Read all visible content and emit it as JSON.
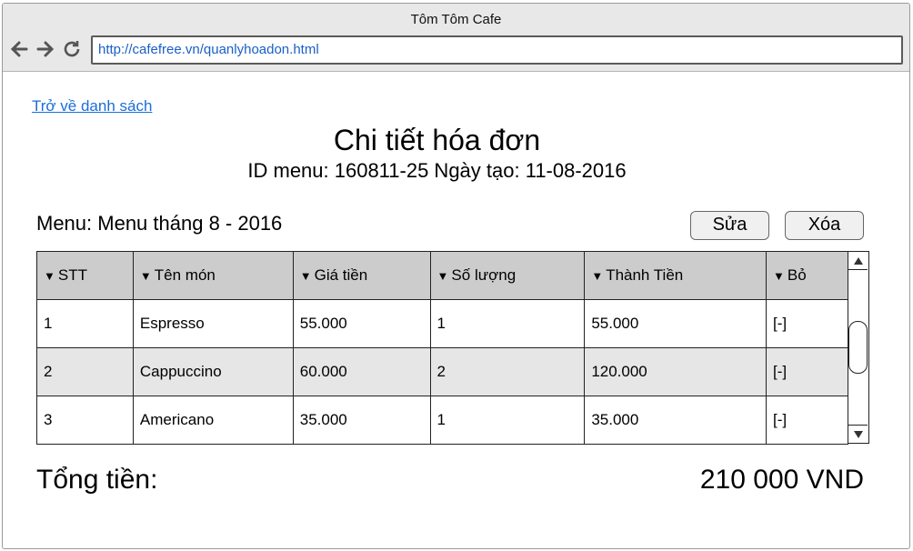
{
  "window": {
    "title": "Tôm Tôm Cafe",
    "url": "http://cafefree.vn/quanlyhoadon.html"
  },
  "page": {
    "back_link": "Trở về danh sách",
    "title": "Chi tiết hóa đơn",
    "subtitle": "ID menu: 160811-25 Ngày tạo: 11-08-2016",
    "menu_label": "Menu: Menu tháng 8 - 2016",
    "edit_label": "Sửa",
    "delete_label": "Xóa"
  },
  "table": {
    "headers": [
      "STT",
      "Tên món",
      "Giá tiền",
      "Số lượng",
      "Thành Tiền",
      "Bỏ"
    ],
    "rows": [
      [
        "1",
        "Espresso",
        "55.000",
        "1",
        "55.000",
        "[-]"
      ],
      [
        "2",
        "Cappuccino",
        "60.000",
        "2",
        "120.000",
        "[-]"
      ],
      [
        "3",
        "Americano",
        "35.000",
        "1",
        "35.000",
        "[-]"
      ]
    ]
  },
  "total": {
    "label": "Tổng tiền:",
    "value": "210 000 VND"
  },
  "icons": {
    "back": "arrow-left-icon",
    "forward": "arrow-right-icon",
    "reload": "reload-icon",
    "sort": "sort-down-icon"
  }
}
